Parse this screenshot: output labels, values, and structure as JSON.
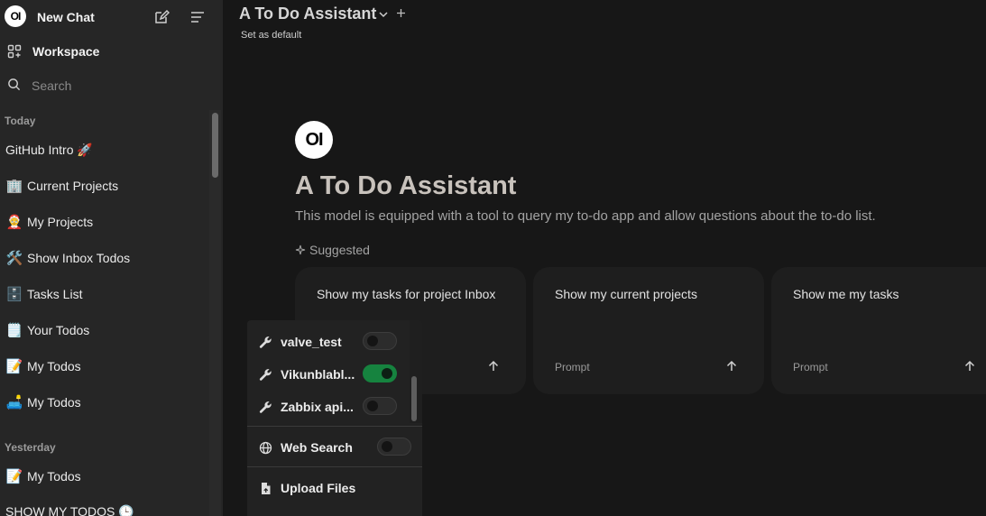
{
  "sidebar": {
    "logo_text": "OI",
    "new_chat_label": "New Chat",
    "workspace_label": "Workspace",
    "search_placeholder": "Search",
    "sections": [
      {
        "label": "Today",
        "items": [
          {
            "emoji": "",
            "label": "GitHub Intro 🚀"
          },
          {
            "emoji": "🏢",
            "label": "Current Projects"
          },
          {
            "emoji": "🤶",
            "label": "My Projects"
          },
          {
            "emoji": "🛠️",
            "label": "Show Inbox Todos"
          },
          {
            "emoji": "🗄️",
            "label": "Tasks List"
          },
          {
            "emoji": "🗒️",
            "label": "Your Todos"
          },
          {
            "emoji": "📝",
            "label": "My Todos"
          },
          {
            "emoji": "🛋️",
            "label": "My Todos"
          }
        ]
      },
      {
        "label": "Yesterday",
        "items": [
          {
            "emoji": "📝",
            "label": "My Todos"
          },
          {
            "emoji": "",
            "label": "SHOW MY TODOS 🕒"
          }
        ]
      }
    ]
  },
  "header": {
    "model_name": "A To Do Assistant",
    "set_default": "Set as default"
  },
  "hero": {
    "logo_text": "OI",
    "title": "A To Do Assistant",
    "description": "This model is equipped with a tool to query my to-do app and allow questions about the to-do list.",
    "suggested_label": "Suggested"
  },
  "suggestions": [
    {
      "title": "Show my tasks for project Inbox",
      "sub": ""
    },
    {
      "title": "Show my current projects",
      "sub": "Prompt"
    },
    {
      "title": "Show me my tasks",
      "sub": "Prompt"
    }
  ],
  "tools_menu": {
    "tools": [
      {
        "label": "valve_test",
        "enabled": false
      },
      {
        "label": "Vikunblabl...",
        "enabled": true
      },
      {
        "label": "Zabbix api...",
        "enabled": false
      }
    ],
    "web_search_label": "Web Search",
    "web_search_enabled": false,
    "upload_label": "Upload Files"
  },
  "colors": {
    "background": "#171717",
    "sidebar": "#262626",
    "toggle_on": "#16833f"
  }
}
